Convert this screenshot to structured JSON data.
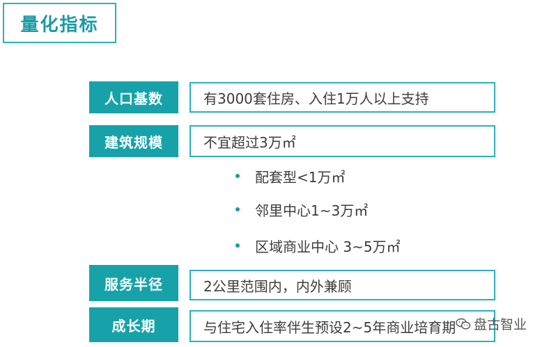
{
  "title": "量化指标",
  "rows": [
    {
      "label": "人口基数",
      "value": "有3000套住房、入住1万人以上支持"
    },
    {
      "label": "建筑规模",
      "value": "不宜超过3万㎡"
    },
    {
      "label": "服务半径",
      "value": "2公里范围内，内外兼顾"
    },
    {
      "label": "成长期",
      "value": "与住宅入住率伴生预设2~5年商业培育期"
    }
  ],
  "bullets": [
    "配套型<1万㎡",
    "邻里中心1~3万㎡",
    "区域商业中心 3~5万㎡"
  ],
  "watermark": {
    "text": "盘古智业",
    "icon": "wechat-icon"
  },
  "colors": {
    "accent": "#17a2aa",
    "border": "#2ab0b8",
    "text": "#3c3c3c"
  }
}
